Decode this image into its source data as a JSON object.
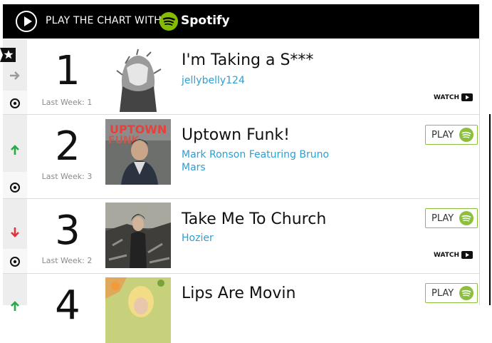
{
  "banner": {
    "text": "PLAY THE CHART WITH",
    "brand": "Spotify"
  },
  "colors": {
    "artist_link": "#2c9fd3",
    "spotify_green": "#8bbf3e",
    "up_arrow": "#2aa84a",
    "down_arrow": "#e0333a",
    "same_arrow": "#9a9a9a"
  },
  "chart": {
    "rows": [
      {
        "rank": "1",
        "last_week": "Last Week: 1",
        "title": "I'm Taking a S***",
        "artist": "jellybelly124",
        "movement": "same",
        "play_label": "",
        "watch_label": "WATCH"
      },
      {
        "rank": "2",
        "last_week": "Last Week: 3",
        "title": "Uptown Funk!",
        "artist": "Mark Ronson Featuring Bruno Mars",
        "movement": "up",
        "play_label": "PLAY",
        "watch_label": ""
      },
      {
        "rank": "3",
        "last_week": "Last Week: 2",
        "title": "Take Me To Church",
        "artist": "Hozier",
        "movement": "down",
        "play_label": "PLAY",
        "watch_label": "WATCH"
      },
      {
        "rank": "4",
        "last_week": "",
        "title": "Lips Are Movin",
        "artist": "",
        "movement": "up",
        "play_label": "PLAY",
        "watch_label": ""
      }
    ]
  }
}
